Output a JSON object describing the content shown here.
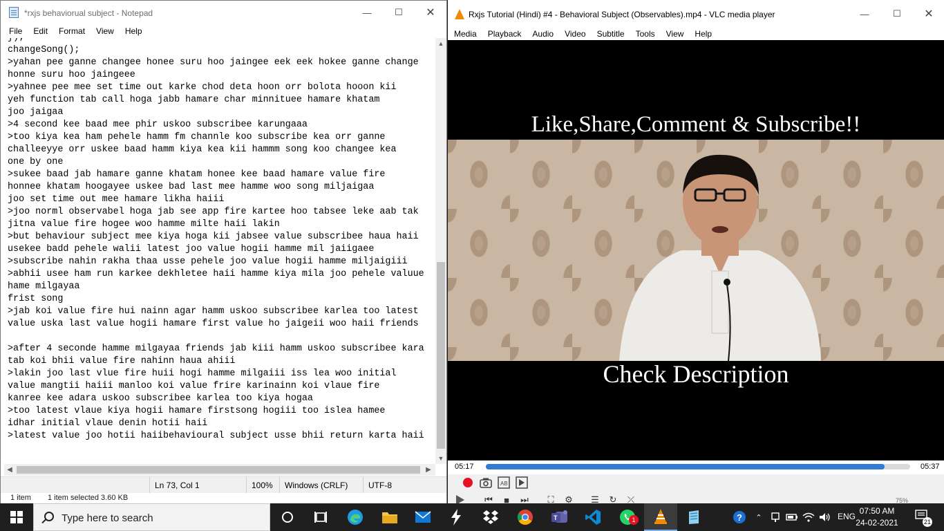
{
  "notepad": {
    "title": "*rxjs behaviorual subject - Notepad",
    "menu": [
      "File",
      "Edit",
      "Format",
      "View",
      "Help"
    ],
    "lines": [
      "});",
      "changeSong();",
      ">yahan pee ganne changee honee suru hoo jaingee eek eek hokee ganne change",
      "honne suru hoo jaingeee",
      ">yahnee pee mee set time out karke chod deta hoon orr bolota hooon kii",
      "yeh function tab call hoga jabb hamare char minnituee hamare khatam",
      "joo jaigaa",
      ">4 second kee baad mee phir uskoo subscribee karungaaa",
      ">too kiya kea ham pehele hamm fm channle koo subscribe kea orr ganne",
      "challeeyye orr uskee baad hamm kiya kea kii hammm song koo changee kea",
      "one by one",
      ">sukee baad jab hamare ganne khatam honee kee baad hamare value fire",
      "honnee khatam hoogayee uskee bad last mee hamme woo song miljaigaa",
      "joo set time out mee hamare likha haiii",
      ">joo norml observabel hoga jab see app fire kartee hoo tabsee leke aab tak",
      "jitna value fire hogee woo hamme milte haii lakin",
      ">but behaviour subject mee kiya hoga kii jabsee value subscribee haua haii",
      "usekee badd pehele walii latest joo value hogii hamme mil jaiigaee",
      ">subscribe nahin rakha thaa usse pehele joo value hogii hamme miljaigiii",
      ">abhii usee ham run karkee dekhletee haii hamme kiya mila joo pehele valuue",
      "hame milgayaa",
      "frist song",
      ">jab koi value fire hui nainn agar hamm uskoo subscribee karlea too latest",
      "value uska last value hogii hamare first value ho jaigeii woo haii friends",
      "",
      ">after 4 seconde hamme milgayaa friends jab kiii hamm uskoo subscribee kara",
      "tab koi bhii value fire nahinn haua ahiii",
      ">lakin joo last vlue fire huii hogi hamme milgaiii iss lea woo initial",
      "value mangtii haiii manloo koi value frire karinainn koi vlaue fire",
      "kanree kee adara uskoo subscribee karlea too kiya hogaa",
      ">too latest vlaue kiya hogii hamare firstsong hogiii too islea hamee",
      "idhar initial vlaue denin hotii haii",
      ">latest value joo hotii haiibehavioural subject usse bhii return karta haii"
    ],
    "status": {
      "position": "Ln 73, Col 1",
      "zoom": "100%",
      "line_ending": "Windows (CRLF)",
      "encoding": "UTF-8"
    },
    "explorer_status": {
      "items": "1 item",
      "selected": "1 item selected  3.60 KB"
    }
  },
  "vlc": {
    "title": "Rxjs Tutorial (Hindi) #4 -  Behavioral Subject (Observables).mp4 - VLC media player",
    "menu": [
      "Media",
      "Playback",
      "Audio",
      "Video",
      "Subtitle",
      "Tools",
      "View",
      "Help"
    ],
    "video_top_caption": "Like,Share,Comment & Subscribe!!",
    "video_bottom_caption": "Check Description",
    "elapsed": "05:17",
    "total": "05:37",
    "progress": 0.94,
    "volume": "75%"
  },
  "taskbar": {
    "search_placeholder": "Type here to search",
    "language": "ENG",
    "time": "07:50 AM",
    "date": "24-02-2021",
    "whatsapp_badge": "1",
    "notification_count": "21"
  },
  "colors": {
    "vlc_orange": "#f08a00",
    "seek_blue": "#2f7bd6",
    "record_red": "#e81123",
    "taskbar_bg": "#1f1f1f"
  }
}
